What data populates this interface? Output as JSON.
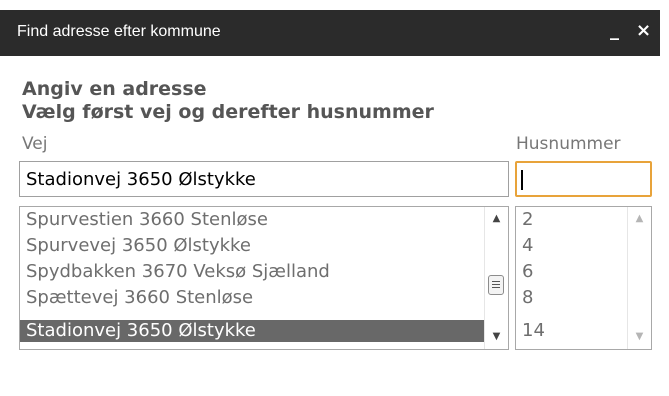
{
  "window": {
    "title": "Find adresse efter kommune",
    "minimize_glyph": "_",
    "close_glyph": "×"
  },
  "headings": {
    "line1": "Angiv en adresse",
    "line2": "Vælg først vej og derefter husnummer"
  },
  "fields": {
    "vej_label": "Vej",
    "husnummer_label": "Husnummer",
    "vej_value": "Stadionvej 3650 Ølstykke",
    "husnummer_value": ""
  },
  "vej_list": {
    "items": [
      "Spurvestien 3660 Stenløse",
      "Spurvevej 3650 Ølstykke",
      "Spydbakken 3670 Veksø Sjælland",
      "Spættevej 3660 Stenløse",
      "Stadionvej 3650 Ølstykke"
    ],
    "selected": "Stadionvej 3650 Ølstykke"
  },
  "husnummer_list": {
    "items": [
      "2",
      "4",
      "6",
      "8",
      "14"
    ]
  },
  "icons": {
    "scroll_up": "▲",
    "scroll_down": "▼"
  },
  "colors": {
    "titlebar_bg": "#2b2b2b",
    "focus_border": "#e8a33a",
    "selected_bg": "#686868"
  }
}
